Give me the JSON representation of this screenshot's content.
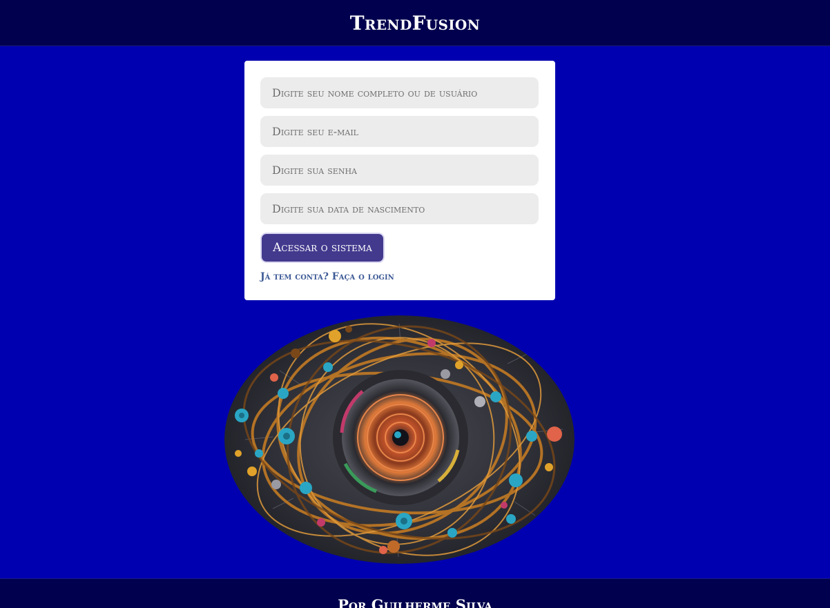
{
  "header": {
    "brand": "TrendFusion"
  },
  "form": {
    "name_placeholder": "Digite seu nome completo ou de usuário",
    "email_placeholder": "Digite seu e-mail",
    "password_placeholder": "Digite sua senha",
    "birthdate_placeholder": "Digite sua data de nascimento",
    "submit_label": "Acessar o sistema",
    "login_link": "Já tem conta? Faça o login"
  },
  "hero_image": {
    "icon": "swirl-artwork-image"
  },
  "footer": {
    "credit": "Por Guilherme Silva"
  },
  "colors": {
    "page_bg": "#0000b0",
    "bar_bg": "#00004e",
    "button_bg": "#433a8e",
    "link": "#3d5a96"
  }
}
